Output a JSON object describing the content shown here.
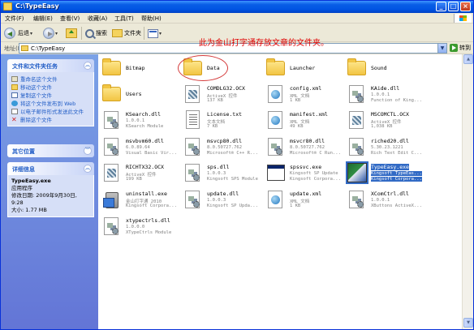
{
  "window": {
    "title": "C:\\TypeEasy"
  },
  "menu": [
    "文件(F)",
    "编辑(E)",
    "查看(V)",
    "收藏(A)",
    "工具(T)",
    "帮助(H)"
  ],
  "toolbar": {
    "back": "后退",
    "search": "搜索",
    "folders": "文件夹"
  },
  "address": {
    "label": "地址(D)",
    "path": "C:\\TypeEasy",
    "go": "转到"
  },
  "annotation": "此为金山打字通存放文章的文件夹。",
  "tasks_panel": {
    "title": "文件和文件夹任务",
    "items": [
      "重命名这个文件",
      "移动这个文件",
      "复制这个文件",
      "将这个文件发布到 Web",
      "以电子邮件形式发送此文件",
      "删除这个文件"
    ]
  },
  "other_places": {
    "title": "其它位置"
  },
  "details": {
    "title": "详细信息",
    "name": "TypeEasy.exe",
    "type": "应用程序",
    "modified_label": "修改日期: 2009年9月30日, 9:28",
    "size_label": "大小: 1.77 MB"
  },
  "files": [
    {
      "name": "Bitmap",
      "kind": "folder",
      "d1": "",
      "d2": ""
    },
    {
      "name": "Data",
      "kind": "folder",
      "d1": "",
      "d2": ""
    },
    {
      "name": "Launcher",
      "kind": "folder",
      "d1": "",
      "d2": ""
    },
    {
      "name": "Sound",
      "kind": "folder",
      "d1": "",
      "d2": ""
    },
    {
      "name": "Users",
      "kind": "folder",
      "d1": "",
      "d2": ""
    },
    {
      "name": "COMDLG32.OCX",
      "kind": "ocx",
      "d1": "ActiveX 控件",
      "d2": "137 KB"
    },
    {
      "name": "config.xml",
      "kind": "xml",
      "d1": "XML 文档",
      "d2": "1 KB"
    },
    {
      "name": "KAide.dll",
      "kind": "dll",
      "d1": "1.0.0.1",
      "d2": "Function of King..."
    },
    {
      "name": "KSearch.dll",
      "kind": "dll",
      "d1": "1.0.0.1",
      "d2": "KSearch Module"
    },
    {
      "name": "License.txt",
      "kind": "txt",
      "d1": "文本文档",
      "d2": "7 KB"
    },
    {
      "name": "manifest.xml",
      "kind": "xml",
      "d1": "XML 文档",
      "d2": "49 KB"
    },
    {
      "name": "MSCOMCTL.OCX",
      "kind": "ocx",
      "d1": "ActiveX 控件",
      "d2": "1,038 KB"
    },
    {
      "name": "msvbvm60.dll",
      "kind": "dll",
      "d1": "6.0.89.64",
      "d2": "Visual Basic Vir..."
    },
    {
      "name": "msvcp80.dll",
      "kind": "dll",
      "d1": "8.0.50727.762",
      "d2": "Microsoft® C++ R..."
    },
    {
      "name": "msvcr80.dll",
      "kind": "dll",
      "d1": "8.0.50727.762",
      "d2": "Microsoft® C Run..."
    },
    {
      "name": "riched20.dll",
      "kind": "dll",
      "d1": "5.30.23.1221",
      "d2": "Rich Text Edit C..."
    },
    {
      "name": "RICHTX32.OCX",
      "kind": "ocx",
      "d1": "ActiveX 控件",
      "d2": "199 KB"
    },
    {
      "name": "sps.dll",
      "kind": "dll",
      "d1": "1.0.0.3",
      "d2": "Kingsoft SPS Module"
    },
    {
      "name": "spssvc.exe",
      "kind": "exe",
      "d1": "Kingsoft SP Update",
      "d2": "Kingsoft Corpora..."
    },
    {
      "name": "TypeEasy.exe",
      "kind": "typeeasy",
      "d1": "Kingsoft TypeEas...",
      "d2": "Kingsoft Corpora..."
    },
    {
      "name": "uninstall.exe",
      "kind": "uninstall",
      "d1": "金山打字通 2010",
      "d2": "Kingsoft Corpora..."
    },
    {
      "name": "update.dll",
      "kind": "dll",
      "d1": "1.0.0.3",
      "d2": "Kingsoft SP Upda..."
    },
    {
      "name": "update.xml",
      "kind": "xml",
      "d1": "XML 文档",
      "d2": "1 KB"
    },
    {
      "name": "XComCtrl.dll",
      "kind": "dll",
      "d1": "1.0.0.1",
      "d2": "XButtons ActiveX..."
    },
    {
      "name": "xtypectrls.dll",
      "kind": "dll",
      "d1": "1.0.0.0",
      "d2": "XTypeCtrls Module"
    }
  ],
  "selected_file": "TypeEasy.exe"
}
